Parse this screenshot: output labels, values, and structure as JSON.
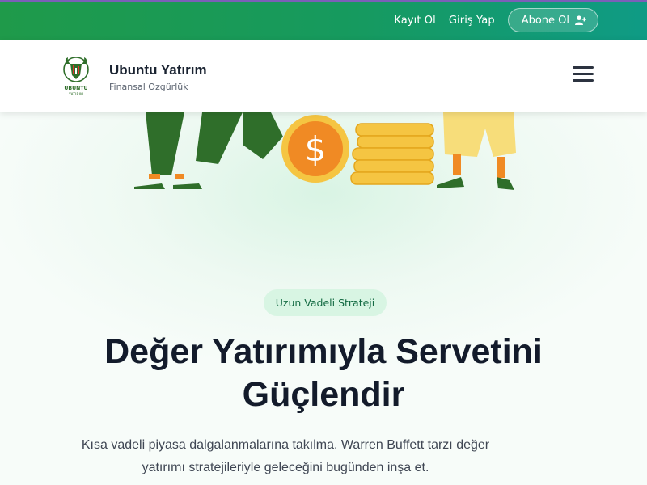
{
  "topbar": {
    "register_label": "Kayıt Ol",
    "login_label": "Giriş Yap",
    "subscribe_label": "Abone Ol",
    "subscribe_icon": "user-plus-icon"
  },
  "header": {
    "logo_text_top": "UBUNTU",
    "logo_text_bottom": "YATIRIM",
    "brand_title": "Ubuntu Yatırım",
    "brand_subtitle": "Finansal Özgürlük",
    "menu_icon": "hamburger-menu-icon"
  },
  "hero": {
    "badge": "Uzun Vadeli Strateji",
    "headline_line1": "Değer Yatırımıyla Servetini",
    "headline_line2": "Güçlendir",
    "description_line1": "Kısa vadeli piyasa dalgalanmalarına takılma. Warren Buffett tarzı değer",
    "description_line2": "yatırımı stratejileriyle geleceğini bugünden inşa et.",
    "coin_symbol": "$"
  },
  "colors": {
    "topbar_start": "#1f9a4a",
    "topbar_end": "#0f9b85",
    "brand_green": "#2f6e2a",
    "coin_orange": "#f08a24",
    "coin_gold": "#f5c542",
    "badge_bg": "#d8f5e3",
    "headline": "#131b2b"
  }
}
